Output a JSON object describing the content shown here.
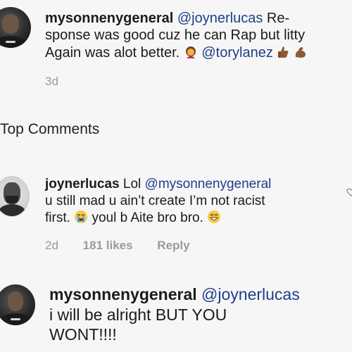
{
  "comments": [
    {
      "username": "mysonnenygeneral",
      "mention": "@joynerlucas",
      "line1_rest": " Re-",
      "line2": "sponse was good cuz he can Rap but litty",
      "line3": "Again was alot better.",
      "mention2": "@torylanez",
      "time": "3d"
    },
    {
      "username": "joynerlucas",
      "prefix": "Lol",
      "mention": "@mysonnenygeneral",
      "line2": "u still mad u ain’t create I’m not racist",
      "line3a": "first.",
      "line3b": " youl b Aite bro bro.",
      "time": "2d",
      "likes": "181 likes",
      "reply": "Reply"
    },
    {
      "username": "mysonnenygeneral",
      "mention": "@joynerlucas",
      "line2": "i will be alright BUT YOU",
      "line3": "WONT!!!!"
    }
  ],
  "section": {
    "title": "Top Comments"
  },
  "icons": [
    "woman-emoji",
    "thumbs-up-emoji",
    "flexed-biceps-emoji",
    "crying-face-emoji",
    "grinning-face-emoji",
    "heart-icon"
  ]
}
